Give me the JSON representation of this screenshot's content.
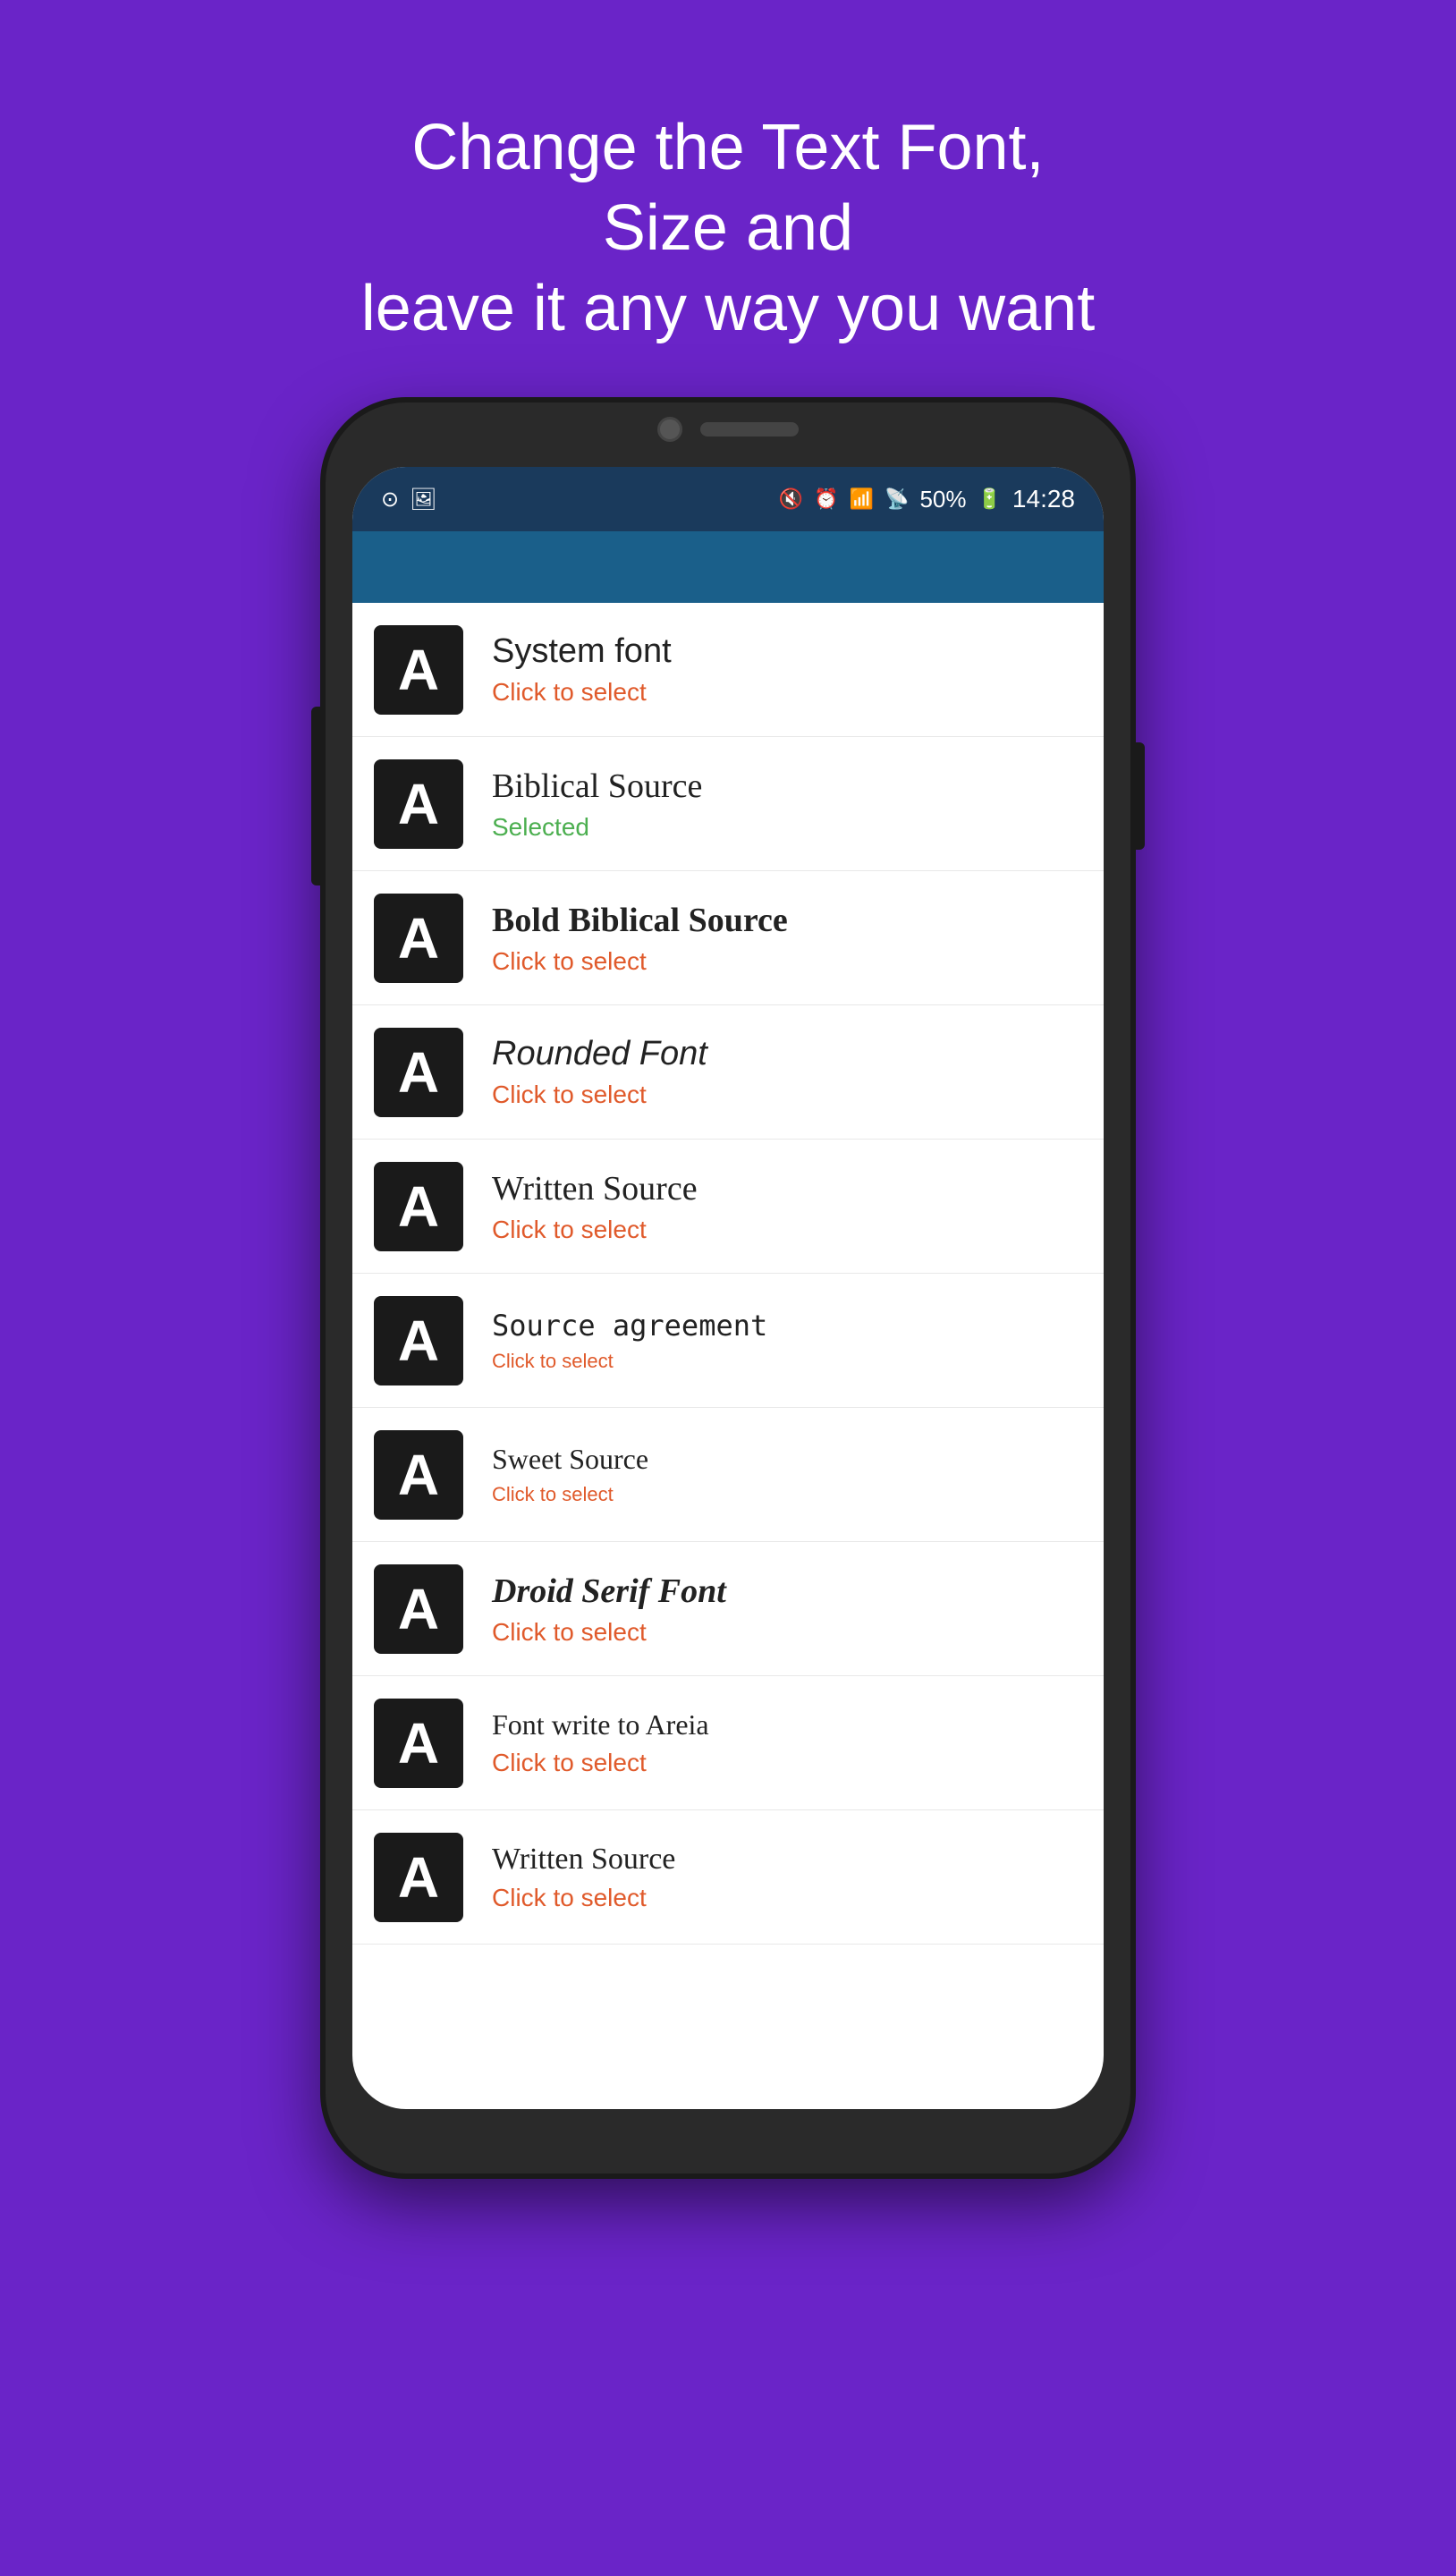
{
  "background_color": "#6a24c8",
  "hero": {
    "line1": "Change the Text Font,",
    "line2": "Size and",
    "line3": "leave it any way you want"
  },
  "phone": {
    "status_bar": {
      "time": "14:28",
      "battery": "50%",
      "icons": [
        "circle-icon",
        "image-icon",
        "mute-icon",
        "alarm-icon",
        "wifi-icon",
        "signal-icon"
      ]
    },
    "font_items": [
      {
        "id": "system",
        "name": "System font",
        "action": "Click to select",
        "action_type": "click",
        "style_class": "font-system"
      },
      {
        "id": "biblical",
        "name": "Biblical Source",
        "action": "Selected",
        "action_type": "selected",
        "style_class": "font-biblical"
      },
      {
        "id": "bold-biblical",
        "name": "Bold Biblical Source",
        "action": "Click to select",
        "action_type": "click",
        "style_class": "font-bold-biblical"
      },
      {
        "id": "rounded",
        "name": "Rounded Font",
        "action": "Click to select",
        "action_type": "click",
        "style_class": "font-rounded"
      },
      {
        "id": "written",
        "name": "Written Source",
        "action": "Click to select",
        "action_type": "click",
        "style_class": "font-written"
      },
      {
        "id": "source-agreement",
        "name": "Source agreement",
        "action": "Click to select",
        "action_type": "click-small",
        "style_class": "font-source-agreement"
      },
      {
        "id": "sweet",
        "name": "Sweet Source",
        "action": "Click to select",
        "action_type": "click-small",
        "style_class": "font-sweet"
      },
      {
        "id": "droid",
        "name": "Droid Serif Font",
        "action": "Click to select",
        "action_type": "click",
        "style_class": "font-droid"
      },
      {
        "id": "write-areia",
        "name": "Font write to Areia",
        "action": "Click to select",
        "action_type": "click",
        "style_class": "font-write-areia"
      },
      {
        "id": "written2",
        "name": "Written Source",
        "action": "Click to select",
        "action_type": "click",
        "style_class": "font-written2"
      }
    ]
  }
}
